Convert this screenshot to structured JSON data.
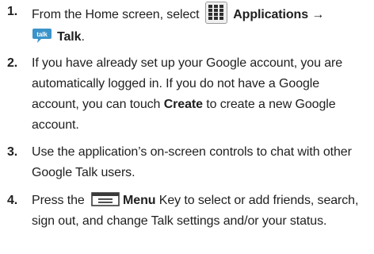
{
  "steps": [
    {
      "num": "1.",
      "line1_pre": "From the Home screen, select ",
      "apps_label": "Applications →",
      "talk_label": "Talk",
      "line2_post": "."
    },
    {
      "num": "2.",
      "lines": [
        "If you have already set up your Google account, you are",
        "automatically logged in. If you do not have a Google"
      ],
      "line3_pre": "account, you can touch ",
      "create_label": "Create",
      "line3_post": " to create a new Google",
      "line4": "account."
    },
    {
      "num": "3.",
      "lines": [
        "Use the application’s on-screen controls to chat with other",
        "Google Talk users."
      ]
    },
    {
      "num": "4.",
      "line1_pre": "Press the ",
      "menu_label": "Menu",
      "line1_post": " Key to select or add friends, search,",
      "line2": "sign out, and change Talk settings and/or your status."
    }
  ],
  "icons": {
    "apps": "applications-grid-icon",
    "talk": "talk-icon",
    "menu": "menu-key-icon",
    "talk_text": "talk",
    "accent": "#3b93c9"
  }
}
